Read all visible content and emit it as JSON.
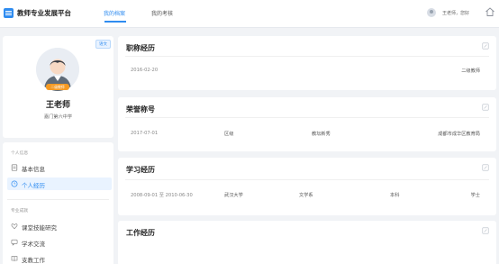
{
  "header": {
    "app_title": "教师专业发展平台",
    "tabs": [
      {
        "label": "我的档案",
        "active": true
      },
      {
        "label": "我的考核",
        "active": false
      }
    ],
    "greeting": "王老师，您好",
    "accent": "#2f8cf0"
  },
  "profile": {
    "dept_tag": "语文",
    "badge": "二级教师",
    "name": "王老师",
    "school": "嘉门第六中学"
  },
  "menu": {
    "group1": "个人信息",
    "items1": [
      {
        "label": "基本信息",
        "icon": "file-icon",
        "active": false
      },
      {
        "label": "个人经历",
        "icon": "clock-icon",
        "active": true
      }
    ],
    "group2": "专业成就",
    "items2": [
      {
        "label": "课堂技能研究",
        "icon": "heart-icon",
        "active": false
      },
      {
        "label": "学术交流",
        "icon": "chat-icon",
        "active": false
      },
      {
        "label": "支教工作",
        "icon": "book-icon",
        "active": false
      }
    ]
  },
  "sections": {
    "title_history": {
      "title": "职称经历",
      "rows": [
        {
          "date": "2016-02-20",
          "value": "二级教师"
        }
      ]
    },
    "honor": {
      "title": "荣誉称号",
      "rows": [
        {
          "date": "2017-07-01",
          "level": "区级",
          "honor": "教坛新秀",
          "issuer": "成都市成华区教育局"
        }
      ]
    },
    "education": {
      "title": "学习经历",
      "rows": [
        {
          "date": "2008-09-01 至 2010-06-30",
          "school": "武汉大学",
          "dept": "文学系",
          "level": "本科",
          "degree": "学士"
        }
      ]
    },
    "work": {
      "title": "工作经历"
    }
  }
}
